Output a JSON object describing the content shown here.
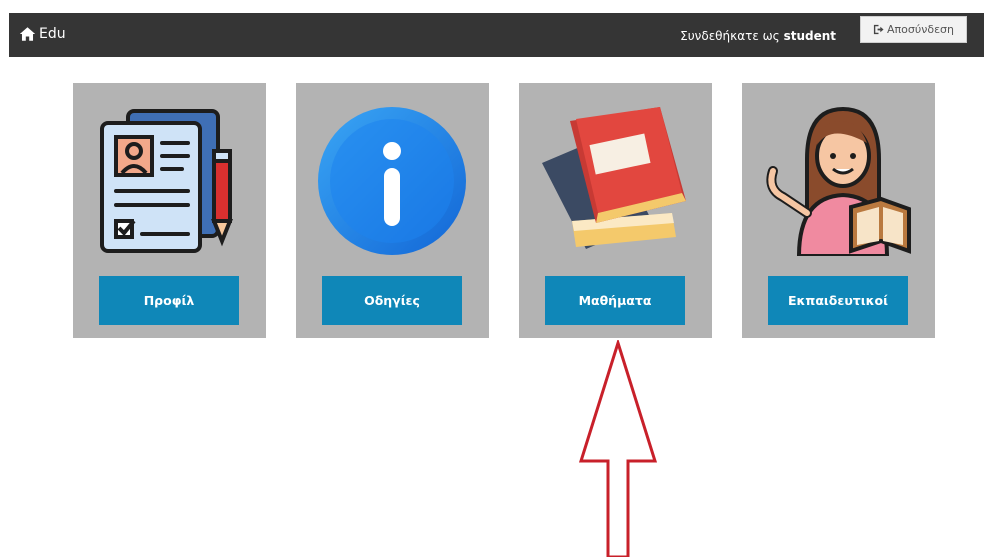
{
  "navbar": {
    "brand_label": "Edu",
    "brand_icon": "home-icon",
    "logged_in_prefix": "Συνδεθήκατε ως",
    "username": "student",
    "logout_label": "Αποσύνδεση",
    "logout_icon": "logout-icon",
    "background": "#353535"
  },
  "cards": [
    {
      "label": "Προφίλ",
      "icon": "profile-document-icon"
    },
    {
      "label": "Οδηγίες",
      "icon": "info-icon"
    },
    {
      "label": "Μαθήματα",
      "icon": "books-icon"
    },
    {
      "label": "Εκπαιδευτικοί",
      "icon": "teacher-icon"
    }
  ],
  "colors": {
    "card_bg": "#b3b3b3",
    "button_bg": "#0f87b8",
    "arrow": "#c8202a"
  }
}
